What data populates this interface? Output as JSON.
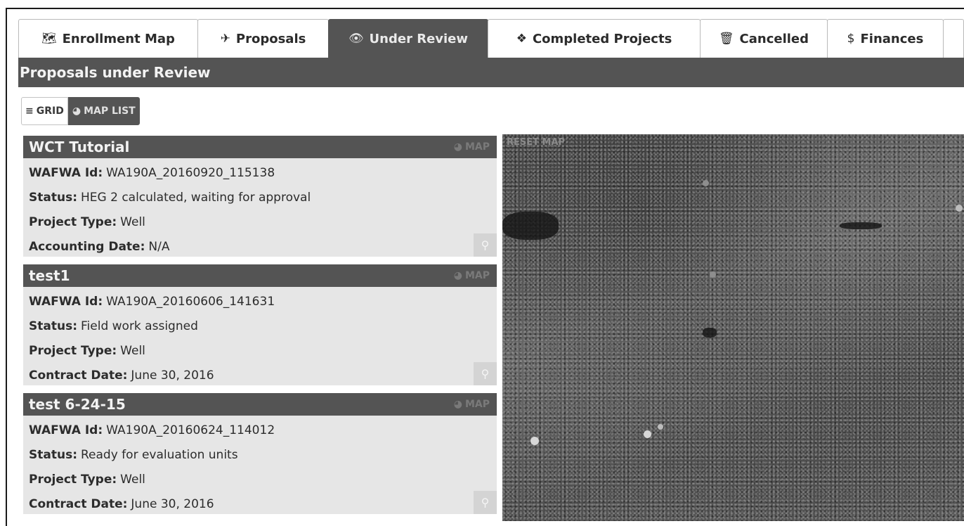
{
  "tabs": [
    {
      "icon": "map-icon",
      "glyph": "🗺",
      "label": "Enrollment Map",
      "active": false
    },
    {
      "icon": "paper-plane-icon",
      "glyph": "✈",
      "label": "Proposals",
      "active": false
    },
    {
      "icon": "eye-icon",
      "glyph": "👁",
      "label": "Under Review",
      "active": true
    },
    {
      "icon": "cubes-icon",
      "glyph": "❖",
      "label": "Completed Projects",
      "active": false
    },
    {
      "icon": "trash-icon",
      "glyph": "🗑",
      "label": "Cancelled",
      "active": false
    },
    {
      "icon": "dollar-icon",
      "glyph": "$",
      "label": "Finances",
      "active": false
    }
  ],
  "header": {
    "title": "Proposals under Review"
  },
  "view_toggle": {
    "grid_label": "GRID",
    "map_list_label": "MAP LIST",
    "grid_glyph": "≡",
    "map_glyph": "◕"
  },
  "map_link_label": "MAP",
  "map_link_glyph": "◕",
  "zoom_glyph": "⚲",
  "cards": [
    {
      "title": "WCT Tutorial",
      "fields": [
        {
          "label": "WAFWA Id:",
          "value": "WA190A_20160920_115138"
        },
        {
          "label": "Status:",
          "value": "HEG 2 calculated, waiting for approval"
        },
        {
          "label": "Project Type:",
          "value": "Well"
        },
        {
          "label": "Accounting Date:",
          "value": "N/A"
        }
      ]
    },
    {
      "title": "test1",
      "fields": [
        {
          "label": "WAFWA Id:",
          "value": "WA190A_20160606_141631"
        },
        {
          "label": "Status:",
          "value": "Field work assigned"
        },
        {
          "label": "Project Type:",
          "value": "Well"
        },
        {
          "label": "Contract Date:",
          "value": "June 30, 2016"
        }
      ]
    },
    {
      "title": "test 6-24-15",
      "fields": [
        {
          "label": "WAFWA Id:",
          "value": "WA190A_20160624_114012"
        },
        {
          "label": "Status:",
          "value": "Ready for evaluation units"
        },
        {
          "label": "Project Type:",
          "value": "Well"
        },
        {
          "label": "Contract Date:",
          "value": "June 30, 2016"
        }
      ]
    }
  ],
  "map": {
    "reset_label": "RESET MAP"
  },
  "colors": {
    "bar": "#545454",
    "card_bg": "#e6e6e6",
    "accent_text": "#f3f3f3"
  }
}
